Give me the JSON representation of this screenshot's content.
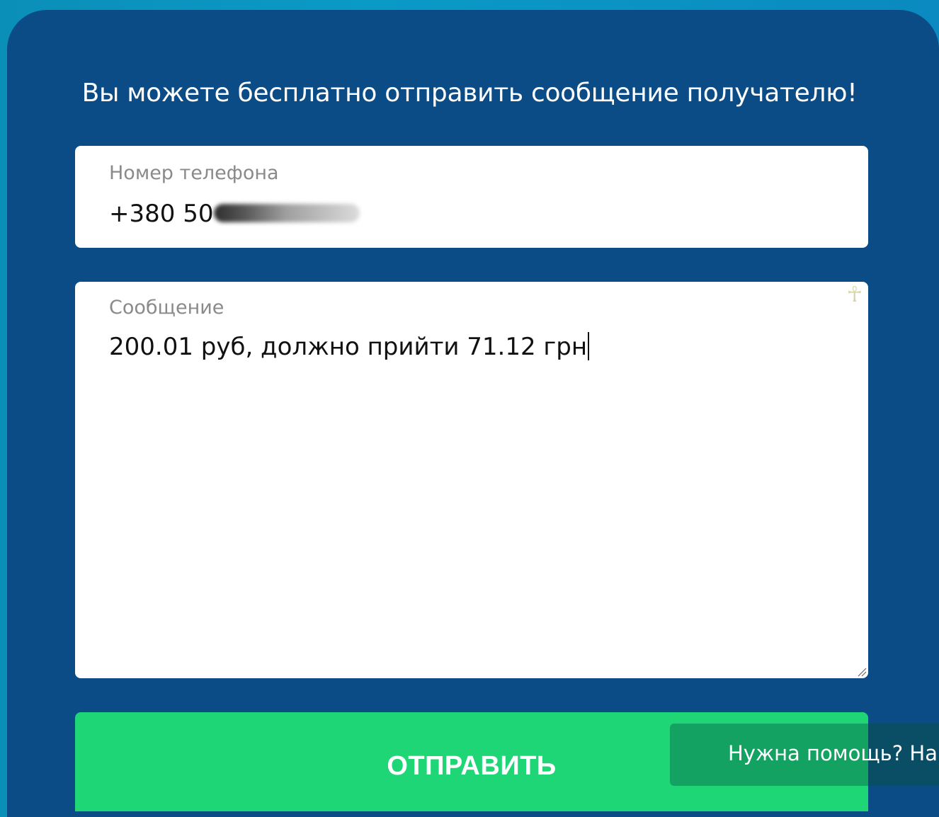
{
  "form": {
    "heading": "Вы можете бесплатно отправить сообщение получателю!",
    "phone": {
      "label": "Номер телефона",
      "value": "+380 50"
    },
    "message": {
      "label": "Сообщение",
      "value": "200.01 руб, должно прийти 71.12 грн"
    },
    "submit_label": "ОТПРАВИТЬ"
  },
  "help_widget": {
    "label": "Нужна помощь? Напи"
  },
  "icons": {
    "field_corner_icon": "ankh-icon",
    "resize_handle": "resize-handle-icon"
  },
  "colors": {
    "background": "#0a9ac6",
    "panel": "#0b4c87",
    "submit_button": "#1fd676",
    "field": "#ffffff",
    "label_text": "#8a8a8a"
  }
}
